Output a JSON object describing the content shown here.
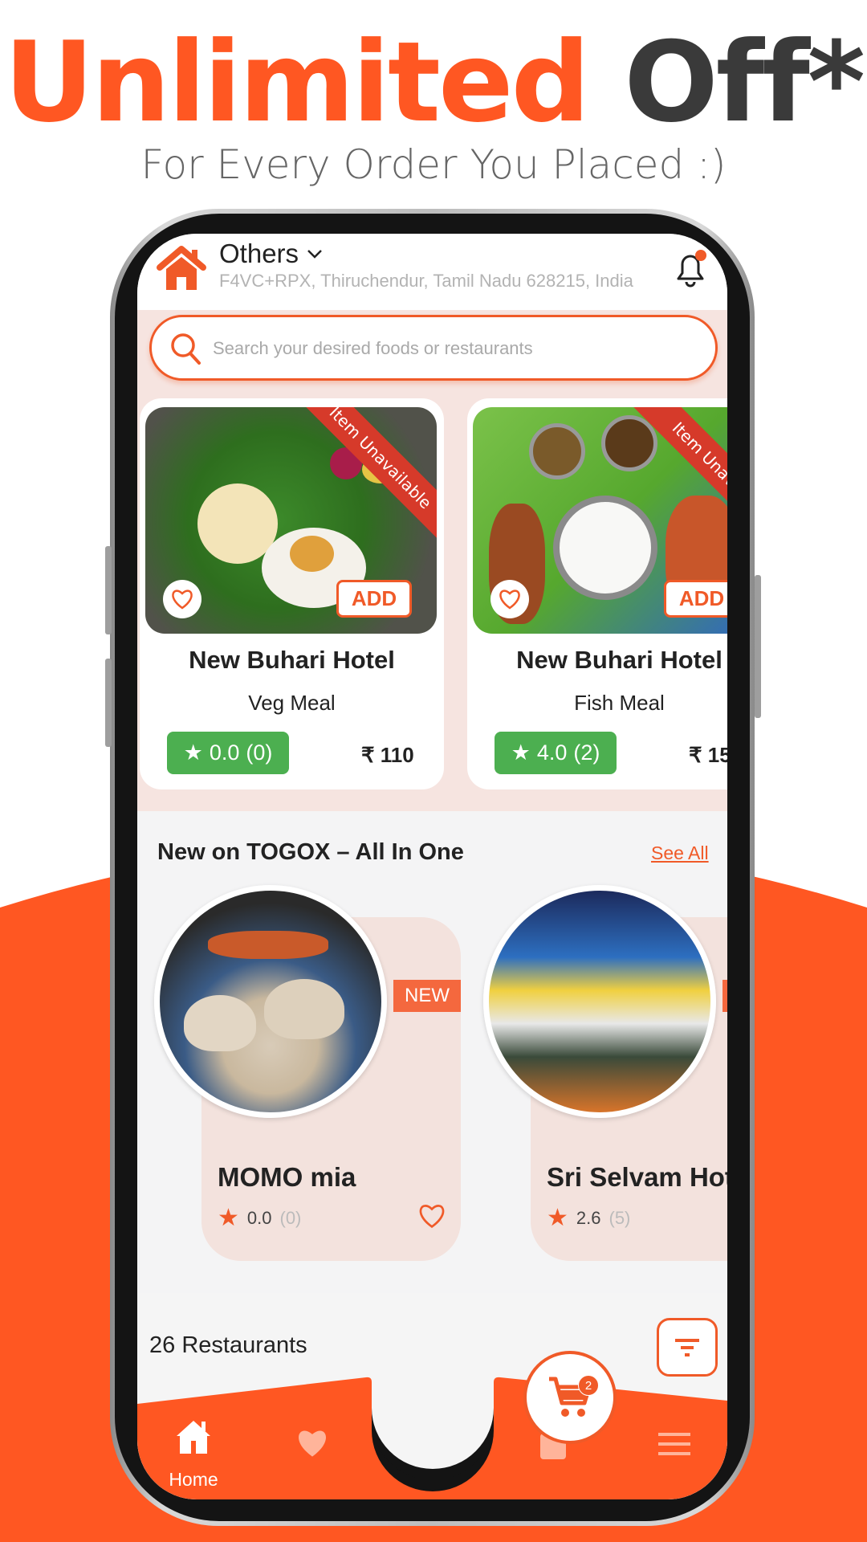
{
  "promo": {
    "headline_accent": "Unlimited",
    "headline_rest": "Off*",
    "subtitle": "For Every Order You Placed :)"
  },
  "colors": {
    "brand": "#ff5722",
    "rating_green": "#4caf50",
    "ribbon_red": "#d63a2a"
  },
  "header": {
    "location_label": "Others",
    "address": "F4VC+RPX, Thiruchendur, Tamil Nadu 628215, India",
    "icons": [
      "home-icon",
      "chevron-down-icon",
      "bell-icon"
    ]
  },
  "search": {
    "placeholder": "Search your desired foods or restaurants"
  },
  "food_items": [
    {
      "restaurant": "New Buhari Hotel",
      "item": "Veg Meal",
      "rating": "0.0",
      "reviews": "(0)",
      "price": "₹ 110",
      "ribbon": "Item Unavailable",
      "add_label": "ADD"
    },
    {
      "restaurant": "New Buhari Hotel",
      "item": "Fish Meal",
      "rating": "4.0",
      "reviews": "(2)",
      "price": "₹ 15",
      "ribbon": "Item Unava",
      "add_label": "ADD"
    }
  ],
  "new_section": {
    "title": "New on TOGOX – All In One",
    "see_all": "See All",
    "restaurants": [
      {
        "name": "MOMO mia",
        "rating": "0.0",
        "reviews": "(0)",
        "badge": "NEW"
      },
      {
        "name": "Sri Selvam Hot",
        "rating": "2.6",
        "reviews": "(5)",
        "badge": ""
      }
    ]
  },
  "restaurants_count": "26 Restaurants",
  "bottom_nav": {
    "home_label": "Home",
    "cart_badge": "2",
    "items": [
      "home-icon",
      "heart-icon",
      "cart-icon",
      "bag-icon",
      "menu-icon"
    ]
  }
}
